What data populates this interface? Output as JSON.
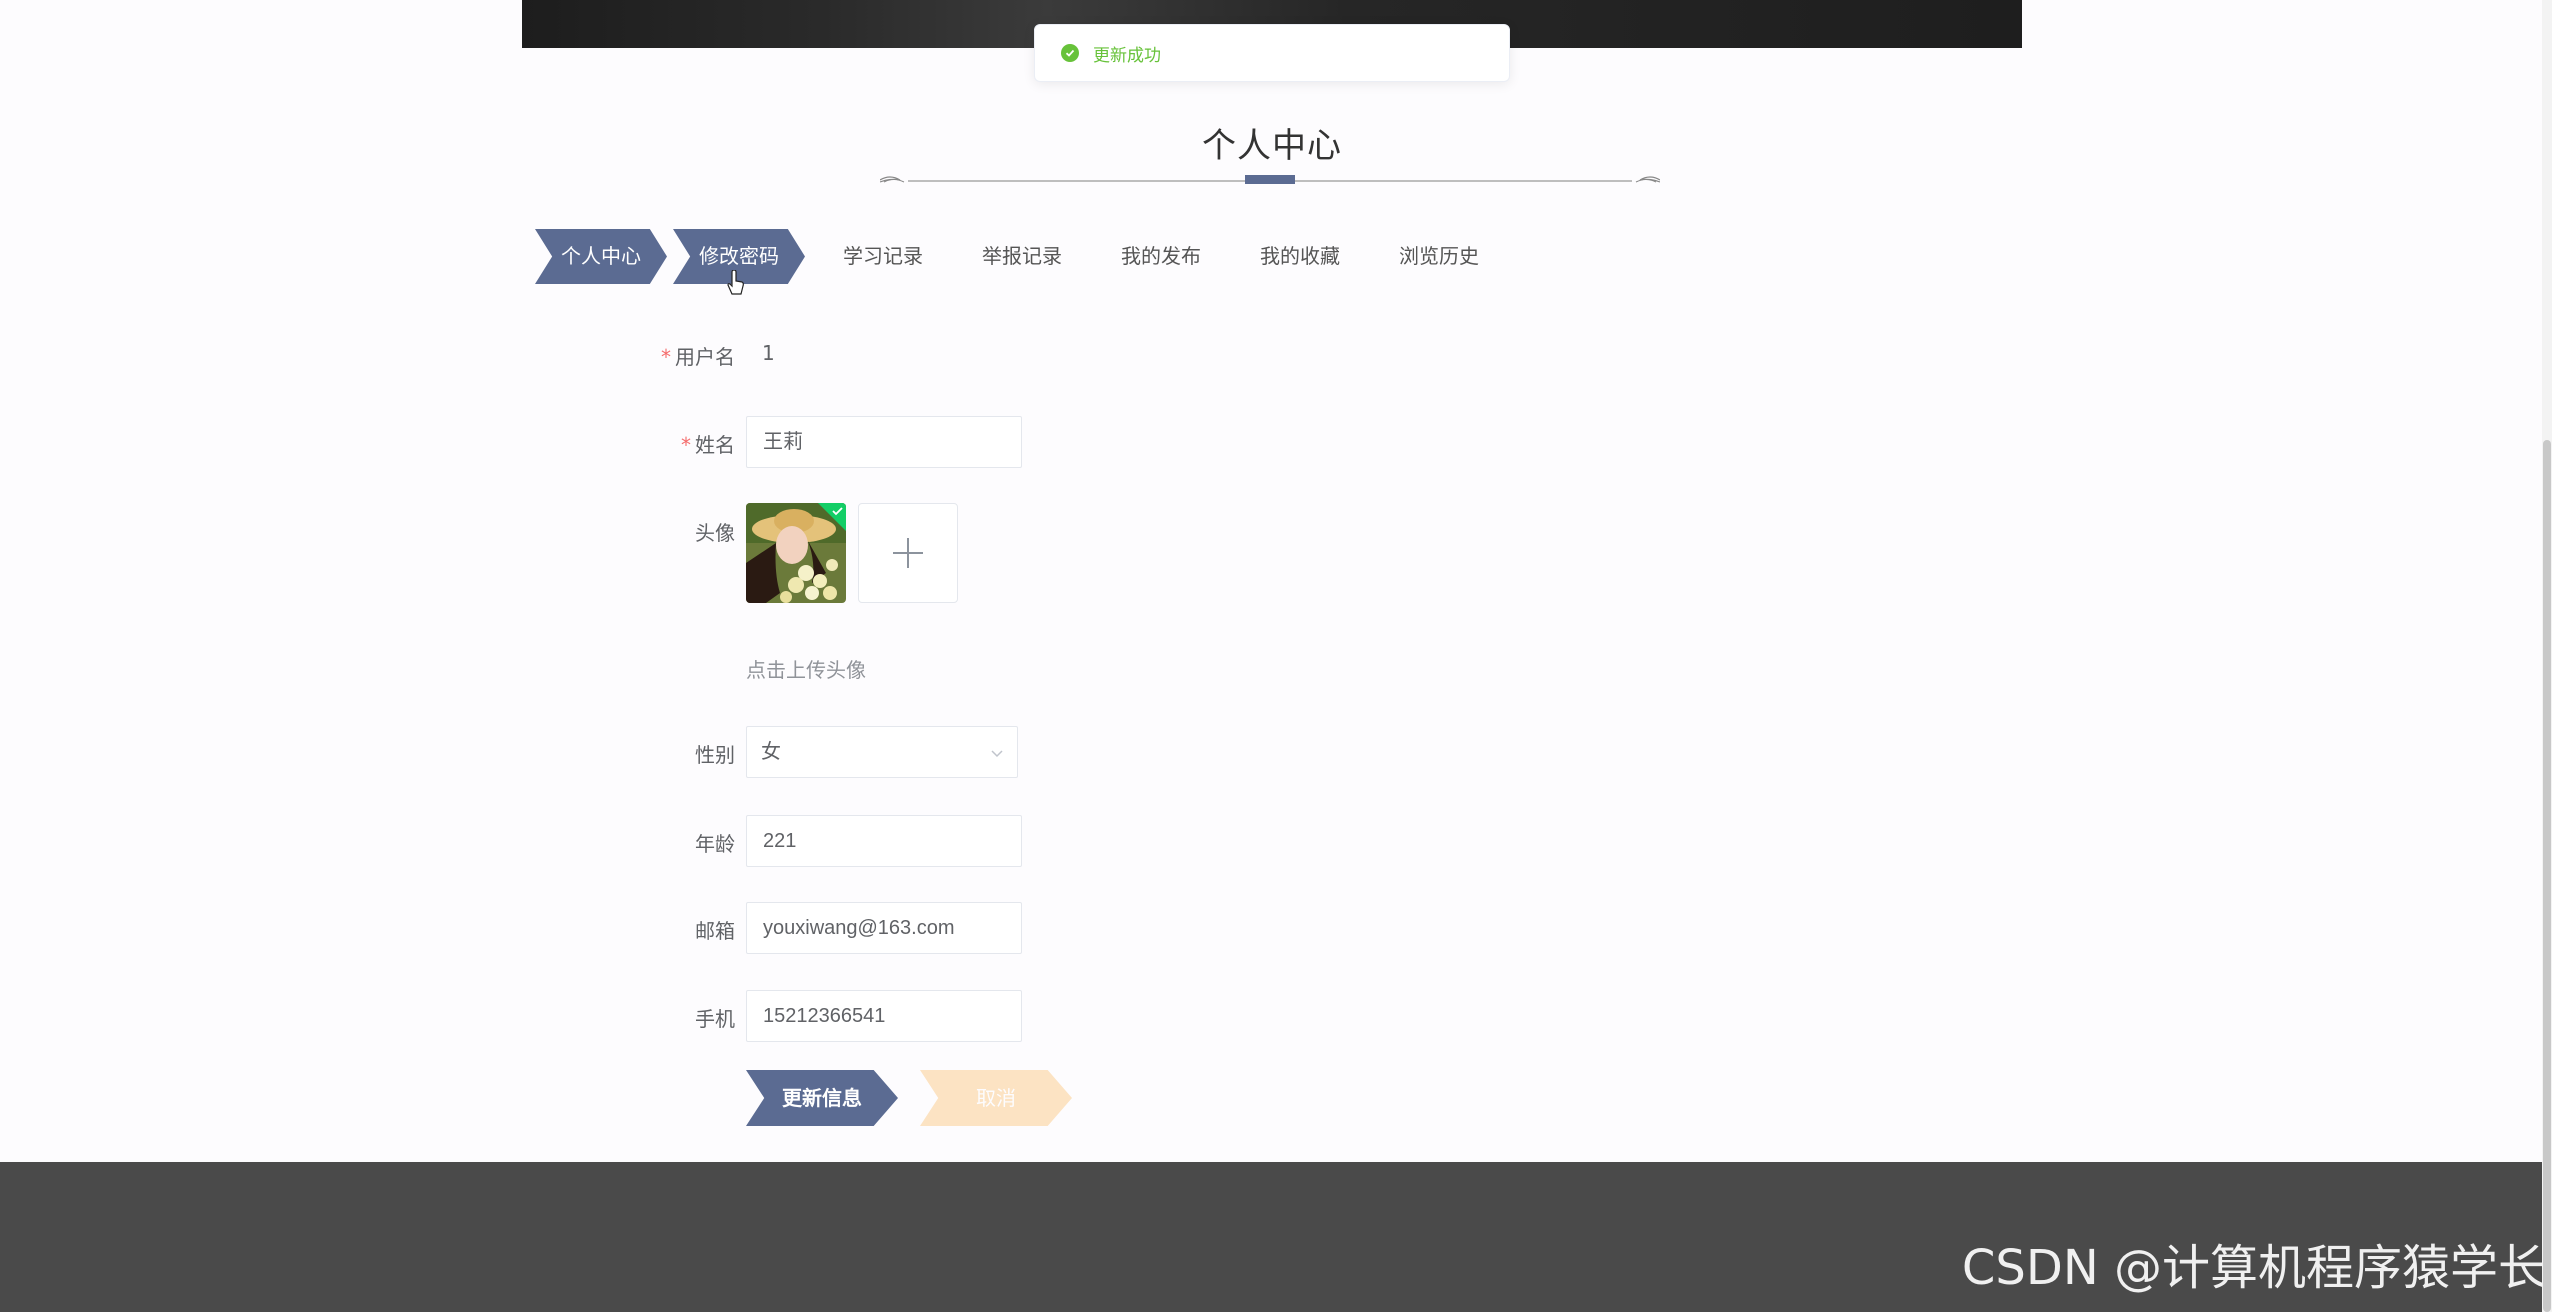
{
  "toast": {
    "message": "更新成功",
    "icon": "success-check-icon",
    "color": "#67c23a"
  },
  "title": "个人中心",
  "tabs": [
    {
      "label": "个人中心",
      "style": "chevron"
    },
    {
      "label": "修改密码",
      "style": "chevron"
    },
    {
      "label": "学习记录",
      "style": "text"
    },
    {
      "label": "举报记录",
      "style": "text"
    },
    {
      "label": "我的发布",
      "style": "text"
    },
    {
      "label": "我的收藏",
      "style": "text"
    },
    {
      "label": "浏览历史",
      "style": "text"
    }
  ],
  "form": {
    "username": {
      "label": "用户名",
      "required": "*",
      "value": "1"
    },
    "name": {
      "label": "姓名",
      "required": "*",
      "value": "王莉"
    },
    "avatar": {
      "label": "头像",
      "hint": "点击上传头像"
    },
    "gender": {
      "label": "性别",
      "value": "女"
    },
    "age": {
      "label": "年龄",
      "value": "221"
    },
    "email": {
      "label": "邮箱",
      "value": "youxiwang@163.com"
    },
    "phone": {
      "label": "手机",
      "value": "15212366541"
    }
  },
  "buttons": {
    "update": "更新信息",
    "cancel": "取消"
  },
  "colors": {
    "primary": "#5b6b92",
    "cancel": "#fce3c3",
    "footer": "#4a4a4a"
  },
  "watermark": "CSDN @计算机程序猿学长"
}
